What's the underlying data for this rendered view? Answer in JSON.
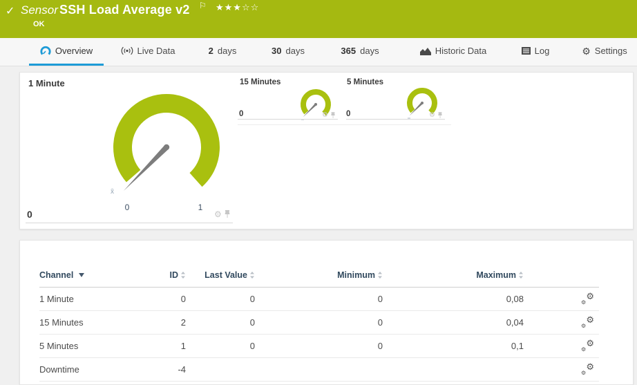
{
  "header": {
    "kind_label": "Sensor",
    "title": "SSH Load Average v2",
    "stars_filled": "★★★",
    "stars_empty": "☆☆",
    "status_text": "OK",
    "bg_color": "#a5b911"
  },
  "tabs": {
    "items": [
      {
        "label": "Overview",
        "icon": "gauge-icon",
        "active": true
      },
      {
        "label": "Live Data",
        "icon": "live-data-icon"
      },
      {
        "strong": "2",
        "label": "days"
      },
      {
        "strong": "30",
        "label": "days"
      },
      {
        "strong": "365",
        "label": "days"
      },
      {
        "label": "Historic Data",
        "icon": "area-chart-icon"
      },
      {
        "label": "Log",
        "icon": "log-icon"
      },
      {
        "label": "Settings",
        "icon": "gear-icon"
      }
    ],
    "active_color": "#1d9bd7"
  },
  "gauges": {
    "arc_color": "#a9c00f",
    "needle_color": "#7d7d7d",
    "primary": {
      "title": "1 Minute",
      "value": "0",
      "scale_min": "0",
      "scale_max": "1",
      "avg_marker": "x̄"
    },
    "secondary": [
      {
        "title": "15 Minutes",
        "value": "0"
      },
      {
        "title": "5 Minutes",
        "value": "0"
      }
    ]
  },
  "table": {
    "columns": [
      "Channel",
      "ID",
      "Last Value",
      "Minimum",
      "Maximum"
    ],
    "header_color": "#31495e",
    "rows": [
      {
        "channel": "1 Minute",
        "id": "0",
        "last_value": "0",
        "minimum": "0",
        "maximum": "0,08"
      },
      {
        "channel": "15 Minutes",
        "id": "2",
        "last_value": "0",
        "minimum": "0",
        "maximum": "0,04"
      },
      {
        "channel": "5 Minutes",
        "id": "1",
        "last_value": "0",
        "minimum": "0",
        "maximum": "0,1"
      },
      {
        "channel": "Downtime",
        "id": "-4",
        "last_value": "",
        "minimum": "",
        "maximum": ""
      }
    ]
  }
}
